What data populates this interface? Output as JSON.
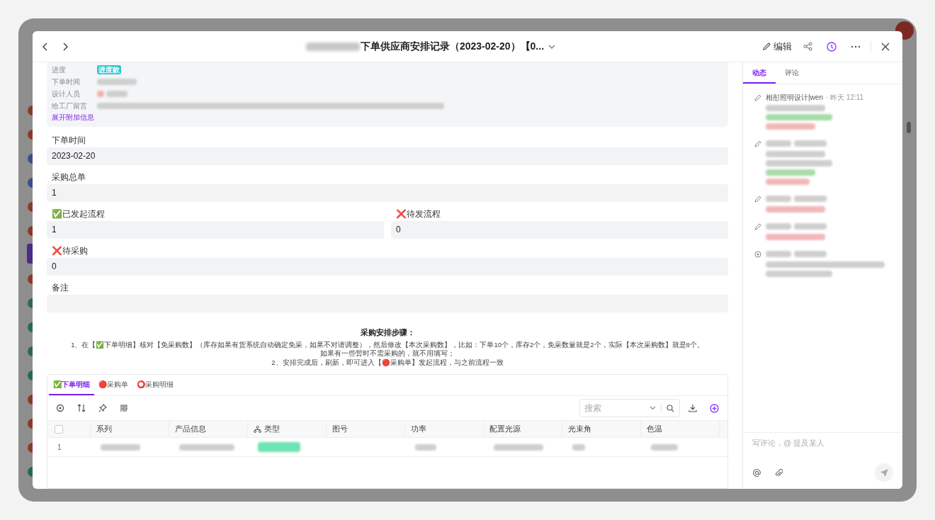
{
  "header": {
    "title": "下单供应商安排记录（2023-02-20）【0...",
    "edit": "编辑"
  },
  "summary": {
    "rows": [
      {
        "label": "进度",
        "kind": "tag",
        "value": "进度款"
      },
      {
        "label": "下单时间",
        "kind": "redacted"
      },
      {
        "label": "设计人员",
        "kind": "person"
      },
      {
        "label": "给工厂留言",
        "kind": "long"
      }
    ],
    "link": "展开附加信息"
  },
  "fields": [
    [
      {
        "label": "下单时间",
        "value": "2023-02-20"
      }
    ],
    [
      {
        "label": "采购总单",
        "value": "1"
      }
    ],
    [
      {
        "label": "✅已发起流程",
        "value": "1"
      },
      {
        "label": "❌待发流程",
        "value": "0"
      }
    ],
    [
      {
        "label": "❌待采购",
        "value": "0"
      }
    ],
    [
      {
        "label": "备注"
      }
    ]
  ],
  "steps": {
    "title": "采购安排步骤：",
    "lines": [
      "1、在【✅下单明细】核对【免采购数】（库存如果有货系统自动确定免采，如果不对请调整），然后修改【本次采购数】，比如：下单10个，库存2个，免采数量就是2个，实际【本次采购数】就是8个。如果有一些暂时不需采购的，就不用填写；",
      "2、安排完成后，刷新，即可进入【🔴采购单】发起流程，与之前流程一致"
    ]
  },
  "table": {
    "tabs": [
      {
        "label": "✅下单明细",
        "selected": true
      },
      {
        "label": "🔴采购单",
        "selected": false
      },
      {
        "label": "⭕采购明细",
        "selected": false
      }
    ],
    "search": {
      "placeholder": "搜索"
    },
    "select_all": {
      "checked": false
    },
    "columns": [
      {
        "label": "系列",
        "kind": "text"
      },
      {
        "label": "产品信息",
        "kind": "text"
      },
      {
        "label": "类型",
        "kind": "lookup"
      },
      {
        "label": "图号",
        "kind": "empty"
      },
      {
        "label": "功率",
        "kind": "text"
      },
      {
        "label": "配置光源",
        "kind": "text"
      },
      {
        "label": "光束角",
        "kind": "text"
      },
      {
        "label": "色温",
        "kind": "text"
      }
    ],
    "rows": [
      {
        "index": "1"
      }
    ]
  },
  "activity": {
    "tabs": [
      {
        "label": "动态",
        "selected": true
      },
      {
        "label": "评论",
        "selected": false
      }
    ],
    "items": [
      {
        "kind": "edit",
        "author": "相彤照明设计|wen",
        "time": "· 昨天 12:11"
      },
      {
        "kind": "edit"
      },
      {
        "kind": "edit"
      },
      {
        "kind": "edit"
      },
      {
        "kind": "status"
      }
    ]
  },
  "comment": {
    "placeholder": "写评论，@ 提及某人"
  }
}
